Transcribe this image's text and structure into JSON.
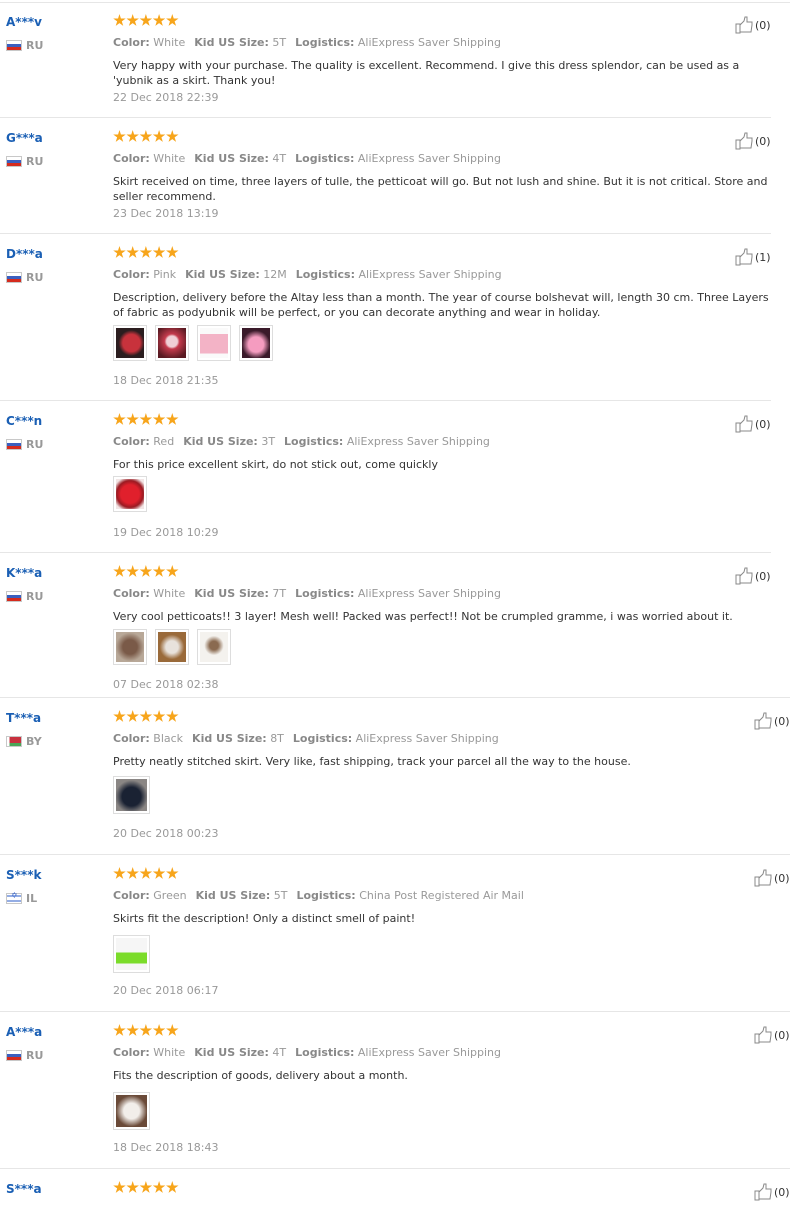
{
  "labels": {
    "color": "Color:",
    "size": "Kid US Size:",
    "logistics": "Logistics:"
  },
  "colors": {
    "username": "#1a5fb4",
    "star": "#f7a51b",
    "meta_text": "#999999"
  },
  "icons": {
    "helpful": "thumbs-up-icon",
    "rating": "star-icon"
  },
  "reviews": [
    {
      "user": "A***v",
      "country": "RU",
      "rating": 5,
      "color": "White",
      "size": "5T",
      "logistics": "AliExpress Saver Shipping",
      "text": "Very happy with your purchase. The quality is excellent. Recommend. I give this dress splendor, can be used as a 'yubnik as a skirt. Thank you!",
      "date": "22 Dec 2018 22:39",
      "helpful": "(0)"
    },
    {
      "user": "G***a",
      "country": "RU",
      "rating": 5,
      "color": "White",
      "size": "4T",
      "logistics": "AliExpress Saver Shipping",
      "text": "Skirt received on time, three layers of tulle, the petticoat will go. But not lush and shine. But it is not critical. Store and seller recommend.",
      "date": "23 Dec 2018 13:19",
      "helpful": "(0)"
    },
    {
      "user": "D***a",
      "country": "RU",
      "rating": 5,
      "color": "Pink",
      "size": "12M",
      "logistics": "AliExpress Saver Shipping",
      "text": "Description, delivery before the Altay less than a month. The year of course bolshevat will, length 30 cm. Three Layers of fabric as podyubnik will be perfect, or you can decorate anything and wear in holiday.",
      "date": "18 Dec 2018 21:35",
      "helpful": "(1)",
      "photo_count": 4
    },
    {
      "user": "C***n",
      "country": "RU",
      "rating": 5,
      "color": "Red",
      "size": "3T",
      "logistics": "AliExpress Saver Shipping",
      "text": "For this price excellent skirt, do not stick out, come quickly",
      "date": "19 Dec 2018 10:29",
      "helpful": "(0)",
      "photo_count": 1
    },
    {
      "user": "K***a",
      "country": "RU",
      "rating": 5,
      "color": "White",
      "size": "7T",
      "logistics": "AliExpress Saver Shipping",
      "text": "Very cool petticoats!! 3 layer! Mesh well! Packed was perfect!! Not be crumpled gramme, i was worried about it.",
      "date": "07 Dec 2018 02:38",
      "helpful": "(0)",
      "photo_count": 3
    },
    {
      "user": "T***a",
      "country": "BY",
      "rating": 5,
      "color": "Black",
      "size": "8T",
      "logistics": "AliExpress Saver Shipping",
      "text": "Pretty neatly stitched skirt. Very like, fast shipping, track your parcel all the way to the house.",
      "date": "20 Dec 2018 00:23",
      "helpful": "(0)",
      "photo_count": 1
    },
    {
      "user": "S***k",
      "country": "IL",
      "rating": 5,
      "color": "Green",
      "size": "5T",
      "logistics": "China Post Registered Air Mail",
      "text": "Skirts fit the description! Only a distinct smell of paint!",
      "date": "20 Dec 2018 06:17",
      "helpful": "(0)",
      "photo_count": 1
    },
    {
      "user": "A***a",
      "country": "RU",
      "rating": 5,
      "color": "White",
      "size": "4T",
      "logistics": "AliExpress Saver Shipping",
      "text": "Fits the description of goods, delivery about a month.",
      "date": "18 Dec 2018 18:43",
      "helpful": "(0)",
      "photo_count": 1
    },
    {
      "user": "S***a",
      "rating": 5,
      "helpful": "(0)"
    }
  ]
}
